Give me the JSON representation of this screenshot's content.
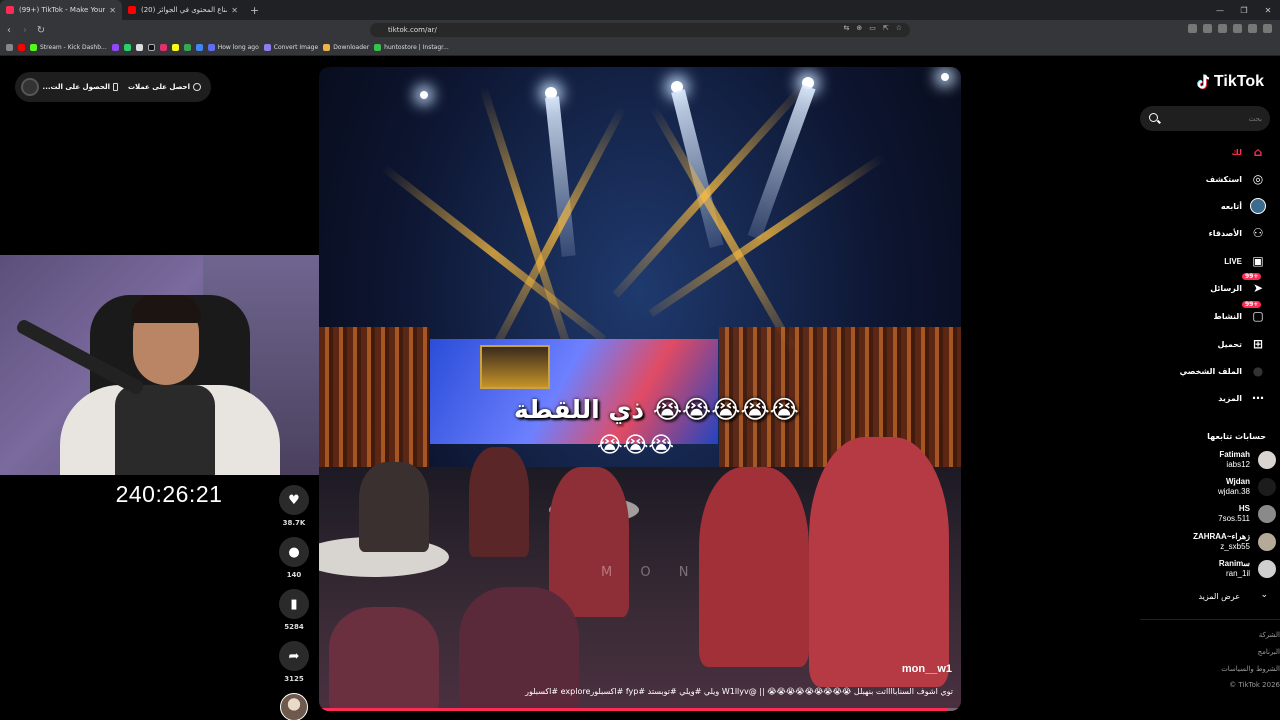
{
  "browser": {
    "tabs": [
      {
        "title": "(99+) TikTok - Make Your Day",
        "active": true,
        "favicon_color": "#fe2c55"
      },
      {
        "title": "(20) لقطات صناع المحتوى في الجوائز",
        "active": false,
        "favicon_color": "#ff0000"
      }
    ],
    "new_tab": "+",
    "url": "tiktok.com/ar/",
    "bookmarks": [
      {
        "label": "Stream - Kick Dashb...",
        "color": "#53fc18"
      },
      {
        "label": "How long ago",
        "color": "#5b6ef5"
      },
      {
        "label": "Convert Image",
        "color": "#8e7cf0"
      },
      {
        "label": "Downloader",
        "color": "#f0b34a"
      },
      {
        "label": "huntostore | Instagr...",
        "color": "#36c24a"
      }
    ]
  },
  "promo": {
    "cta_coins": "احصل على عملات",
    "cta_app": "الحصول على الت..."
  },
  "stream": {
    "timer": "240:26:21"
  },
  "video": {
    "overlay_caption": "ذي اللقطة 😭😭😭😭😭",
    "overlay_emoji_row": "😭😭😭",
    "watermark": "M O N",
    "author": "mon__w1",
    "description": "توي اشوف السنابااااتت بنهبلل 😭😭😭😭😭😭😭😭😭 || @W1llyv ويلي #ويلي #توبستد #fyp #اكسبلورexplore #اكسبلور",
    "progress": 0.98
  },
  "actions": {
    "likes": "38.7K",
    "comments": "140",
    "saves": "5284",
    "shares": "3125"
  },
  "sidebar": {
    "logo": "TikTok",
    "search_placeholder": "بحث",
    "nav": {
      "home": "لك",
      "explore": "استكشف",
      "following": "أتابعه",
      "friends": "الأصدقاء",
      "live": "LIVE",
      "messages": "الرسائل",
      "messages_badge": "99+",
      "activity": "النشاط",
      "activity_badge": "99+",
      "upload": "تحميل",
      "profile": "الملف الشخصي",
      "more": "المزيد"
    },
    "following_header": "حسابات تتابعها",
    "accounts": [
      {
        "name": "Fatimah",
        "handle": "iabs12",
        "avatar": "#d9d4cf"
      },
      {
        "name": "Wjdan",
        "handle": "wjdan.38",
        "avatar": "#1c1c1c"
      },
      {
        "name": "HS",
        "handle": "7sos.511",
        "avatar": "#8a8a8a"
      },
      {
        "name": "ZAHRAA~زهراء",
        "handle": "z_sxb55",
        "avatar": "#b5a99a"
      },
      {
        "name": "Ranimﺳ",
        "handle": "ran_1il",
        "avatar": "#cfcfcf"
      }
    ],
    "see_more": "عرض المزيد",
    "footer": [
      "الشركة",
      "البرنامج",
      "الشروط والسياسات",
      "TikTok 2026 ©"
    ]
  }
}
